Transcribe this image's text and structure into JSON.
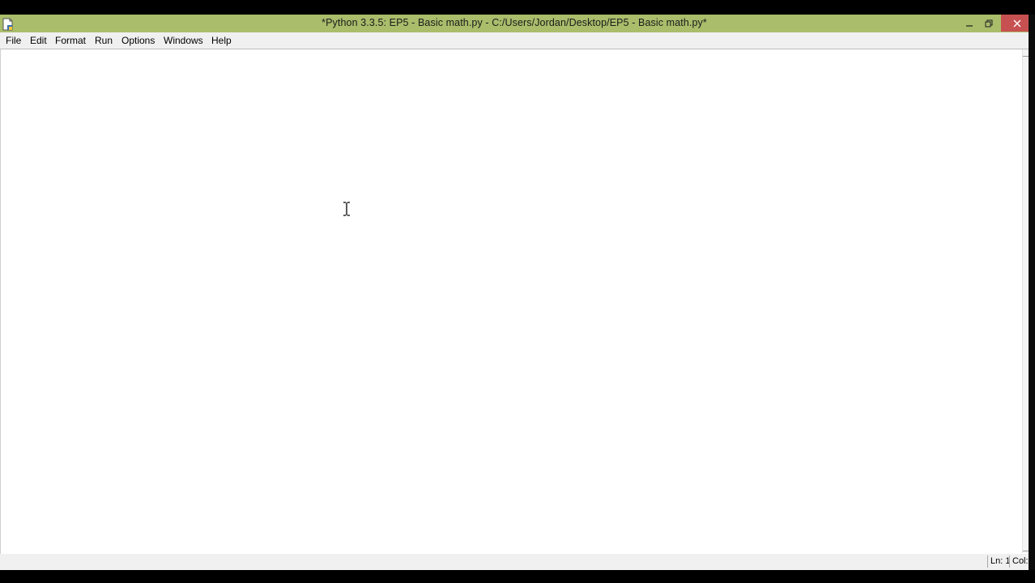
{
  "window": {
    "title": "*Python 3.3.5: EP5 - Basic math.py - C:/Users/Jordan/Desktop/EP5 - Basic math.py*",
    "titlebar_color": "#a9bd6b",
    "close_button_color": "#c75050",
    "icons": {
      "app": "python-file-icon",
      "minimize": "minimize-icon",
      "maximize": "restore-icon",
      "close": "close-icon"
    }
  },
  "menu": {
    "items": [
      {
        "label": "File"
      },
      {
        "label": "Edit"
      },
      {
        "label": "Format"
      },
      {
        "label": "Run"
      },
      {
        "label": "Options"
      },
      {
        "label": "Windows"
      },
      {
        "label": "Help"
      }
    ]
  },
  "editor": {
    "content": ""
  },
  "status": {
    "line": "Ln: 1",
    "col": "Col:"
  }
}
